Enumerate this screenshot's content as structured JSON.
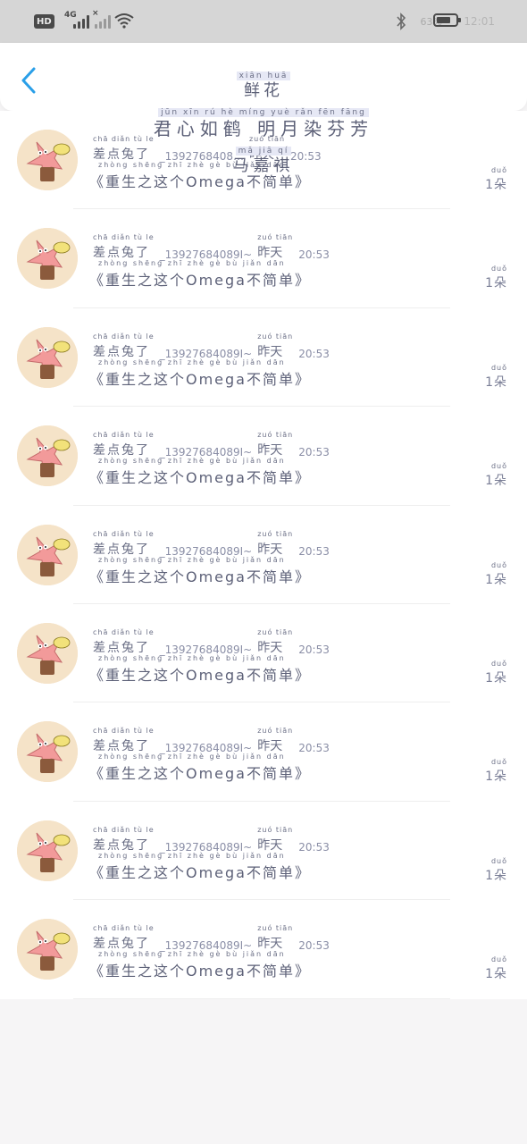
{
  "status_bar": {
    "hd": "HD",
    "network": "4G",
    "battery_percent": "63%",
    "time": "12:01",
    "icons": [
      "hd-icon",
      "signal-icon",
      "no-signal-icon",
      "wifi-icon",
      "bluetooth-icon",
      "battery-icon"
    ]
  },
  "header": {
    "back_icon": "chevron-left-icon",
    "accent": "#2a9fe8",
    "title_pinyin": "xiān  huā",
    "title": "鲜花",
    "subtitle_pinyin": "jūn  xīn  rú  hè  míng  yuè  rǎn  fēn  fāng",
    "subtitle": "君心如鹤 明月染芬芳",
    "author_pinyin": "mǎ  jiā  qí",
    "author": "马嘉祺"
  },
  "rows": [
    {
      "sender_pinyin": "chā diǎn tù le",
      "sender": "差点兔了",
      "phone": "_1392768408…",
      "time_pinyin": "zuó tiān",
      "time_day": "昨天",
      "time": "20:53",
      "title_pinyin": "zhòng shēng zhī zhè gè      bù jiǎn dān",
      "title": "《重生之这个Omega不简单》",
      "count_pinyin": "duǒ",
      "count": "1朵"
    },
    {
      "sender_pinyin": "chā diǎn tù le",
      "sender": "差点兔了",
      "phone": "_13927684089I~",
      "time_pinyin": "zuó tiān",
      "time_day": "昨天",
      "time": "20:53",
      "title_pinyin": "zhòng shēng zhī zhè gè      bù jiǎn dān",
      "title": "《重生之这个Omega不简单》",
      "count_pinyin": "duǒ",
      "count": "1朵"
    },
    {
      "sender_pinyin": "chā diǎn tù le",
      "sender": "差点兔了",
      "phone": "_13927684089I~",
      "time_pinyin": "zuó tiān",
      "time_day": "昨天",
      "time": "20:53",
      "title_pinyin": "zhòng shēng zhī zhè gè      bù jiǎn dān",
      "title": "《重生之这个Omega不简单》",
      "count_pinyin": "duǒ",
      "count": "1朵"
    },
    {
      "sender_pinyin": "chā diǎn tù le",
      "sender": "差点兔了",
      "phone": "_13927684089I~",
      "time_pinyin": "zuó tiān",
      "time_day": "昨天",
      "time": "20:53",
      "title_pinyin": "zhòng shēng zhī zhè gè      bù jiǎn dān",
      "title": "《重生之这个Omega不简单》",
      "count_pinyin": "duǒ",
      "count": "1朵"
    },
    {
      "sender_pinyin": "chā diǎn tù le",
      "sender": "差点兔了",
      "phone": "_13927684089I~",
      "time_pinyin": "zuó tiān",
      "time_day": "昨天",
      "time": "20:53",
      "title_pinyin": "zhòng shēng zhī zhè gè      bù jiǎn dān",
      "title": "《重生之这个Omega不简单》",
      "count_pinyin": "duǒ",
      "count": "1朵"
    },
    {
      "sender_pinyin": "chā diǎn tù le",
      "sender": "差点兔了",
      "phone": "_13927684089I~",
      "time_pinyin": "zuó tiān",
      "time_day": "昨天",
      "time": "20:53",
      "title_pinyin": "zhòng shēng zhī zhè gè      bù jiǎn dān",
      "title": "《重生之这个Omega不简单》",
      "count_pinyin": "duǒ",
      "count": "1朵"
    },
    {
      "sender_pinyin": "chā diǎn tù le",
      "sender": "差点兔了",
      "phone": "_13927684089I~",
      "time_pinyin": "zuó tiān",
      "time_day": "昨天",
      "time": "20:53",
      "title_pinyin": "zhòng shēng zhī zhè gè      bù jiǎn dān",
      "title": "《重生之这个Omega不简单》",
      "count_pinyin": "duǒ",
      "count": "1朵"
    },
    {
      "sender_pinyin": "chā diǎn tù le",
      "sender": "差点兔了",
      "phone": "_13927684089I~",
      "time_pinyin": "zuó tiān",
      "time_day": "昨天",
      "time": "20:53",
      "title_pinyin": "zhòng shēng zhī zhè gè      bù jiǎn dān",
      "title": "《重生之这个Omega不简单》",
      "count_pinyin": "duǒ",
      "count": "1朵"
    },
    {
      "sender_pinyin": "chā diǎn tù le",
      "sender": "差点兔了",
      "phone": "_13927684089I~",
      "time_pinyin": "zuó tiān",
      "time_day": "昨天",
      "time": "20:53",
      "title_pinyin": "zhòng shēng zhī zhè gè      bù jiǎn dān",
      "title": "《重生之这个Omega不简单》",
      "count_pinyin": "duǒ",
      "count": "1朵"
    }
  ]
}
